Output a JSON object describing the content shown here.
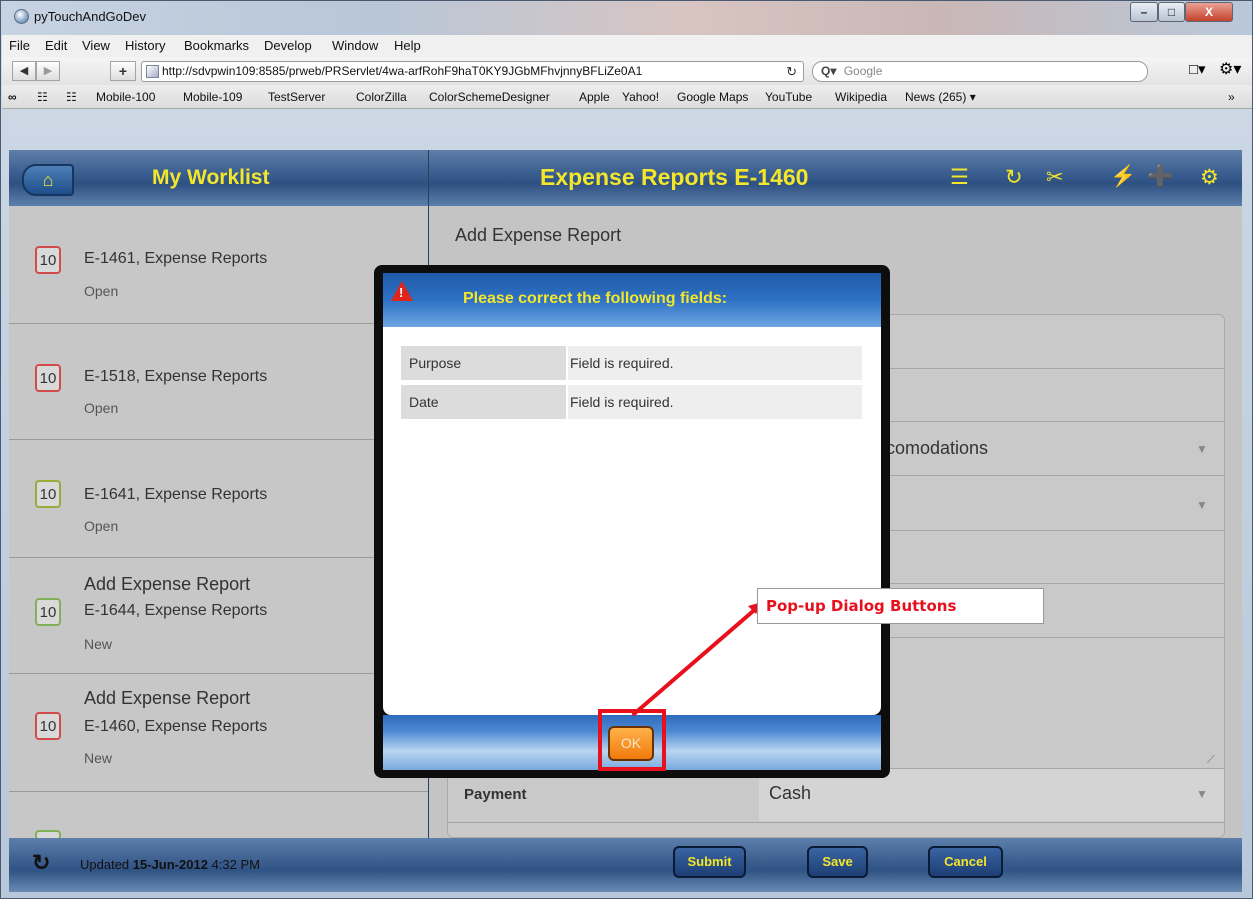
{
  "window": {
    "title": "pyTouchAndGoDev",
    "controls": {
      "minimize": "–",
      "maximize": "□",
      "close": "X"
    }
  },
  "menubar": [
    "File",
    "Edit",
    "View",
    "History",
    "Bookmarks",
    "Develop",
    "Window",
    "Help"
  ],
  "toolbar": {
    "back": "◀",
    "forward": "▶",
    "add": "+",
    "url": "http://sdvpwin109:8585/prweb/PRServlet/4wa-arfRohF9haT0KY9JGbMFhvjnnyBFLiZe0A1",
    "reload": "↻",
    "search_prefix": "Q▾",
    "search_placeholder": "Google",
    "page_menu": "□▾",
    "gear_menu": "⚙▾"
  },
  "bookmarks": {
    "icons": [
      "∞",
      "☷",
      "☷"
    ],
    "items": [
      "Mobile-100",
      "Mobile-109",
      "TestServer",
      "ColorZilla",
      "ColorSchemeDesigner",
      "Apple",
      "Yahoo!",
      "Google Maps",
      "YouTube",
      "Wikipedia",
      "News (265) ▾"
    ],
    "overflow": "»"
  },
  "header": {
    "home_glyph": "⌂",
    "worklist_title": "My Worklist",
    "case_title": "Expense Reports E-1460",
    "icons": [
      "☰",
      "↻",
      "✂",
      "⚡",
      "➕",
      "⚙"
    ]
  },
  "worklist": [
    {
      "badge": "10",
      "heading": "",
      "title": "E-1461, Expense Reports",
      "status": "Open",
      "badge_color": "#d04d4d"
    },
    {
      "badge": "10",
      "heading": "",
      "title": "E-1518, Expense Reports",
      "status": "Open",
      "badge_color": "#d04d4d"
    },
    {
      "badge": "10",
      "heading": "",
      "title": "E-1641, Expense Reports",
      "status": "Open",
      "badge_color": "#9aab3a"
    },
    {
      "badge": "10",
      "heading": "Add Expense Report",
      "title": "E-1644, Expense Reports",
      "status": "New",
      "badge_color": "#7fb05a"
    },
    {
      "badge": "10",
      "heading": "Add Expense Report",
      "title": "E-1460, Expense Reports",
      "status": "New",
      "badge_color": "#d04d4d"
    }
  ],
  "form": {
    "title": "Add Expense Report",
    "visible_category_fragment": "comodations",
    "payment_label": "Payment",
    "payment_value": "Cash"
  },
  "footer": {
    "refresh_glyph": "↻",
    "updated_prefix": "Updated",
    "updated_date": "15-Jun-2012",
    "updated_time": "4:32 PM",
    "buttons": [
      "Submit",
      "Save",
      "Cancel"
    ]
  },
  "dialog": {
    "title": "Please correct the following fields:",
    "warn_glyph": "!",
    "errors": [
      {
        "field": "Purpose",
        "message": "Field is required."
      },
      {
        "field": "Date",
        "message": "Field is required."
      }
    ],
    "ok_label": "OK"
  },
  "annotation": {
    "label": "Pop-up Dialog Buttons",
    "color": "#e8101c"
  }
}
